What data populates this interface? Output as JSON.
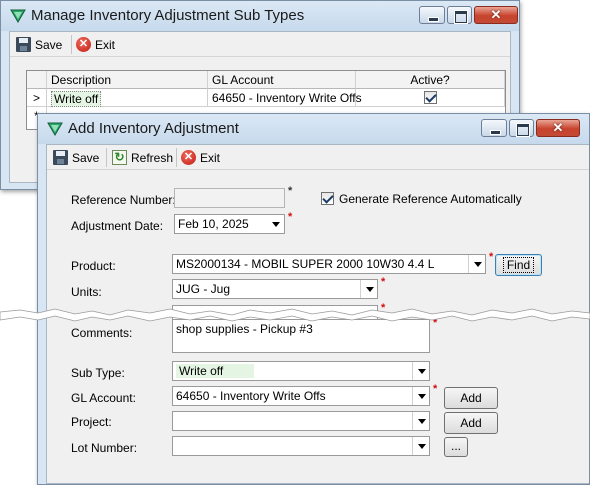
{
  "back_window": {
    "title": "Manage Inventory Adjustment Sub Types",
    "toolbar": {
      "save_label": "Save",
      "exit_label": "Exit"
    },
    "grid": {
      "columns": [
        "Description",
        "GL Account",
        "Active?"
      ],
      "rows": [
        {
          "indicator": ">",
          "description": "Write off",
          "gl_account": "64650 - Inventory Write Offs",
          "active": true
        }
      ],
      "new_row_indicator": "*"
    }
  },
  "front_window": {
    "title": "Add Inventory Adjustment",
    "toolbar": {
      "save_label": "Save",
      "refresh_label": "Refresh",
      "exit_label": "Exit"
    },
    "form": {
      "reference_number": {
        "label": "Reference Number:",
        "value": ""
      },
      "generate_reference": {
        "label": "Generate Reference Automatically",
        "checked": true
      },
      "adjustment_date": {
        "label": "Adjustment Date:",
        "value": "Feb 10, 2025"
      },
      "product": {
        "label": "Product:",
        "value": "MS2000134 - MOBIL SUPER 2000 10W30 4.4 L",
        "find_label": "Find"
      },
      "units": {
        "label": "Units:",
        "value": "JUG - Jug"
      },
      "comments": {
        "label": "Comments:",
        "value": "shop supplies - Pickup #3"
      },
      "sub_type": {
        "label": "Sub Type:",
        "value": "Write off"
      },
      "gl_account": {
        "label": "GL Account:",
        "value": "64650 - Inventory Write Offs",
        "add_label": "Add"
      },
      "project": {
        "label": "Project:",
        "value": "",
        "add_label": "Add"
      },
      "lot_number": {
        "label": "Lot Number:",
        "value": "",
        "browse_label": "..."
      }
    },
    "required_marker": "*"
  },
  "colors": {
    "title_bar": "#c6d9ec",
    "close_button": "#c8432d",
    "selection_green": "#e4f6e3",
    "required_star": "#d01010"
  }
}
